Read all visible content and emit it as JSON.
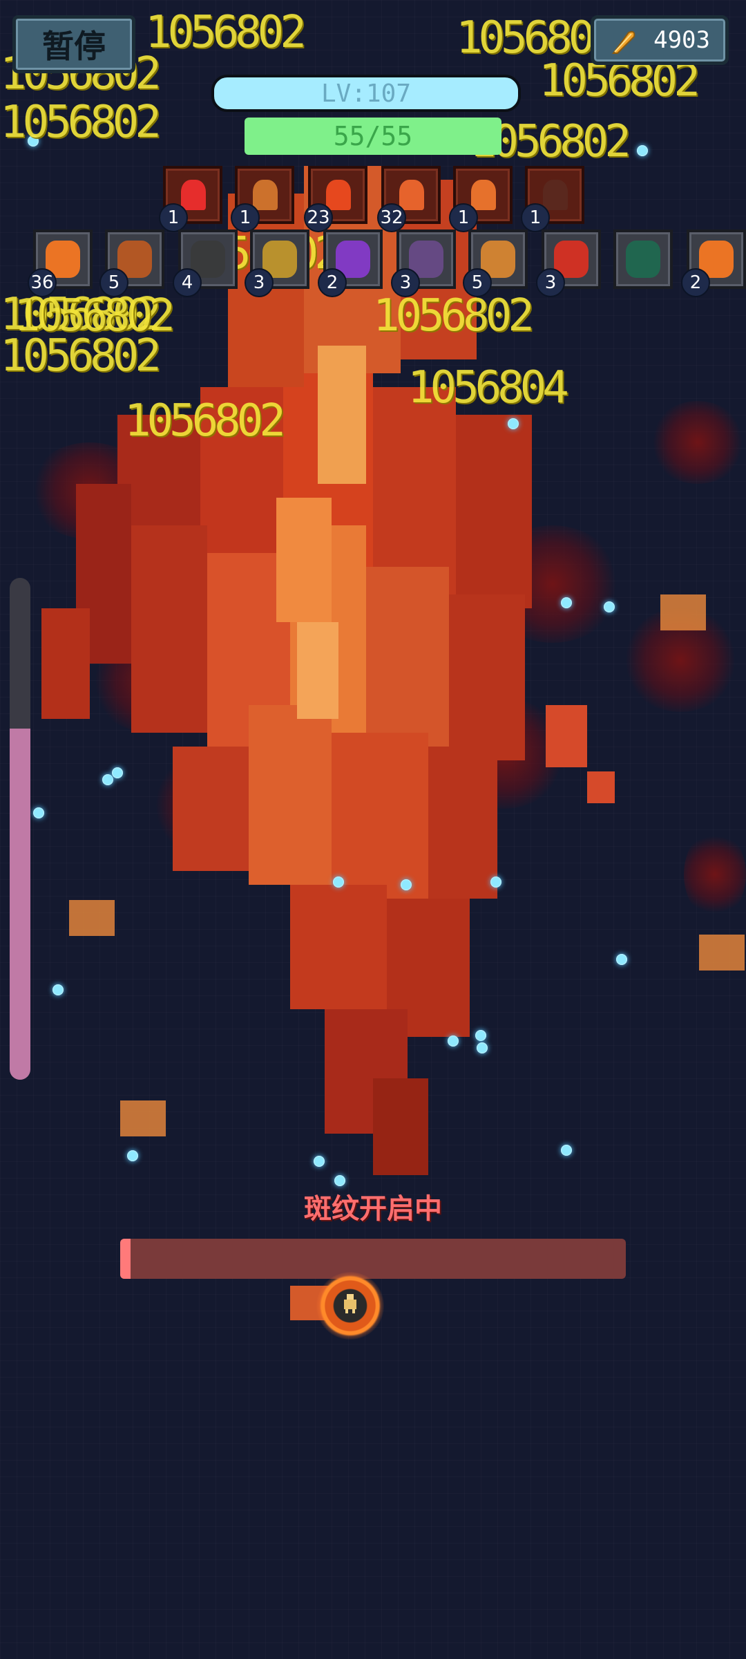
{
  "hud": {
    "pause_label": "暂停",
    "coins": "4903",
    "level_label": "LV:107",
    "hp_label": "55/55"
  },
  "skills": [
    {
      "name": "red-slash-skill",
      "level": "1"
    },
    {
      "name": "crescent-skill",
      "level": "1"
    },
    {
      "name": "fireball-skill",
      "level": "23"
    },
    {
      "name": "flame-burst-skill",
      "level": "32"
    },
    {
      "name": "fire-skill",
      "level": "1"
    },
    {
      "name": "dark-skill",
      "level": "1"
    }
  ],
  "items": [
    {
      "name": "flame-item",
      "level": "36"
    },
    {
      "name": "amulet-item",
      "level": "5"
    },
    {
      "name": "dagger-item",
      "level": "4"
    },
    {
      "name": "bell-item",
      "level": "3"
    },
    {
      "name": "purple-feather-item",
      "level": "2"
    },
    {
      "name": "pouch-item",
      "level": "3"
    },
    {
      "name": "compass-item",
      "level": "5"
    },
    {
      "name": "red-leaf-item",
      "level": "3"
    },
    {
      "name": "green-robe-item",
      "level": ""
    },
    {
      "name": "flame-item-2",
      "level": "2"
    }
  ],
  "damage_numbers": [
    "1056802",
    "1056802",
    "1056802",
    "1056802",
    "1056802",
    "1056802",
    "1056802",
    "1056802",
    "1056802",
    "1056804"
  ],
  "side_gauge": {
    "fill_fraction": 0.7
  },
  "boss": {
    "status_text": "斑纹开启中",
    "progress_fraction": 0.02
  },
  "colors": {
    "background": "#14192f",
    "damage_number": "#f2e43a",
    "hp_bar": "#7ff08a",
    "xp_bar": "#a6ecff",
    "boss_bar": "#7a3a3a",
    "status_text": "#ff6e6e"
  }
}
